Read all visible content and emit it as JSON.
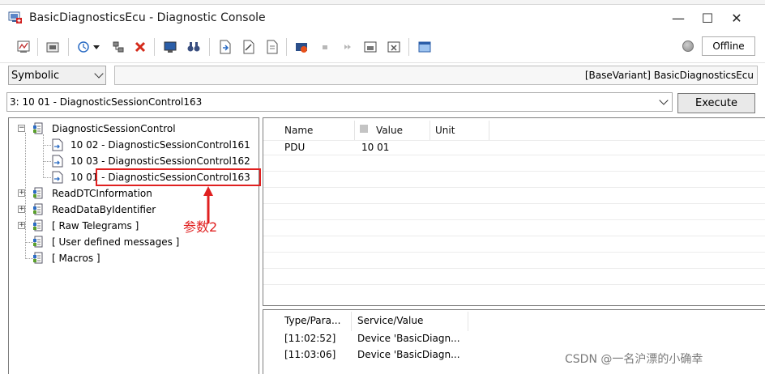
{
  "window": {
    "title": "BasicDiagnosticsEcu - Diagnostic Console",
    "controls": {
      "minimize": "—",
      "maximize": "☐",
      "close": "✕"
    }
  },
  "toolbar": {
    "status": "Offline"
  },
  "mode_select": {
    "value": "Symbolic"
  },
  "variant": {
    "text": "[BaseVariant] BasicDiagnosticsEcu"
  },
  "command": {
    "selected": "3: 10 01 - DiagnosticSessionControl163",
    "execute_label": "Execute"
  },
  "tree": {
    "nodes": [
      {
        "label": "DiagnosticSessionControl",
        "expander": "−"
      },
      {
        "label": "10 02 - DiagnosticSessionControl161"
      },
      {
        "label": "10 03 - DiagnosticSessionControl162"
      },
      {
        "label": "10 01 - DiagnosticSessionControl163"
      },
      {
        "label": "ReadDTCInformation",
        "expander": "+"
      },
      {
        "label": "ReadDataByIdentifier",
        "expander": "+"
      },
      {
        "label": "[ Raw Telegrams ]",
        "expander": "+"
      },
      {
        "label": "[ User defined messages ]"
      },
      {
        "label": "[ Macros ]"
      }
    ]
  },
  "annotation": {
    "text": "参数2"
  },
  "params": {
    "headers": {
      "name": "Name",
      "value": "Value",
      "unit": "Unit"
    },
    "rows": [
      {
        "name": "PDU",
        "value": "10 01",
        "unit": ""
      }
    ]
  },
  "log": {
    "headers": {
      "type": "Type/Para...",
      "service": "Service/Value"
    },
    "rows": [
      {
        "time": "[11:02:52]",
        "service": "Device 'BasicDiagn..."
      },
      {
        "time": "[11:03:06]",
        "service": "Device 'BasicDiagn..."
      }
    ]
  },
  "watermark": {
    "text": "CSDN @一名沪漂的小确幸"
  }
}
